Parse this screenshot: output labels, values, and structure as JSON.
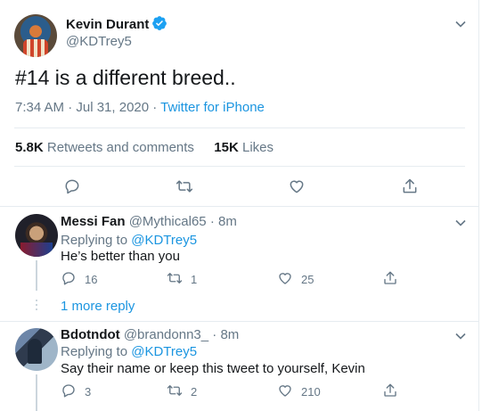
{
  "tweet": {
    "display_name": "Kevin Durant",
    "handle": "@KDTrey5",
    "text": "#14 is a different breed..",
    "time": "7:34 AM · Jul 31, 2020 · ",
    "source": "Twitter for iPhone",
    "retweets_value": "5.8K",
    "retweets_label": "Retweets and comments",
    "likes_value": "15K",
    "likes_label": "Likes"
  },
  "replies": [
    {
      "display_name": "Messi Fan",
      "handle": "@Mythical65",
      "time": "· 8m",
      "replying_prefix": "Replying to ",
      "replying_to": "@KDTrey5",
      "text": "He’s better than you",
      "reply_count": "16",
      "retweet_count": "1",
      "like_count": "25"
    },
    {
      "display_name": "Bdotndot",
      "handle": "@brandonn3_",
      "time": "· 8m",
      "replying_prefix": "Replying to ",
      "replying_to": "@KDTrey5",
      "text": "Say their name or keep this tweet to yourself, Kevin",
      "reply_count": "3",
      "retweet_count": "2",
      "like_count": "210"
    }
  ],
  "more_replies_label": "1 more reply",
  "colors": {
    "accent": "#1b95e0",
    "muted": "#657786",
    "text": "#14171a",
    "border": "#e6ecf0"
  },
  "icons": [
    "verified-badge-icon",
    "chevron-down-icon",
    "reply-icon",
    "retweet-icon",
    "like-icon",
    "share-icon"
  ]
}
